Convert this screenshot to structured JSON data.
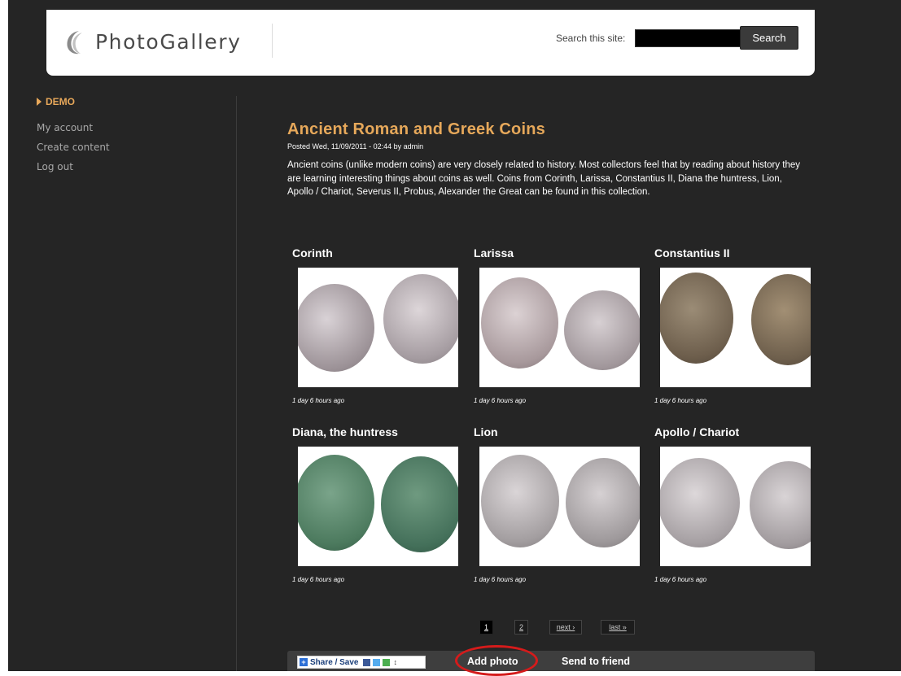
{
  "header": {
    "logo_text": "PhotoGallery",
    "search_label": "Search this site:",
    "search_value": "",
    "search_button": "Search"
  },
  "sidebar": {
    "title": "DEMO",
    "items": [
      "My account",
      "Create content",
      "Log out"
    ]
  },
  "post": {
    "title": "Ancient Roman and Greek Coins",
    "meta": "Posted Wed, 11/09/2011 - 02:44 by admin",
    "description": "Ancient coins (unlike modern coins) are very closely related to history. Most collectors feel that by reading about history they are learning interesting things about coins as well. Coins from Corinth, Larissa, Constantius II, Diana the huntress, Lion, Apollo / Chariot, Severus II, Probus, Alexander the Great can be found in this collection."
  },
  "photos": [
    {
      "title": "Corinth",
      "time": "1 day 6 hours ago",
      "tone": "silver"
    },
    {
      "title": "Larissa",
      "time": "1 day 6 hours ago",
      "tone": "silver"
    },
    {
      "title": "Constantius II",
      "time": "1 day 6 hours ago",
      "tone": "bronze"
    },
    {
      "title": "Diana, the huntress",
      "time": "1 day 6 hours ago",
      "tone": "green"
    },
    {
      "title": "Lion",
      "time": "1 day 6 hours ago",
      "tone": "silver"
    },
    {
      "title": "Apollo / Chariot",
      "time": "1 day 6 hours ago",
      "tone": "silver"
    }
  ],
  "pager": {
    "pages": [
      "1",
      "2"
    ],
    "current": "1",
    "next": "next ›",
    "last": "last »"
  },
  "actions": {
    "share": "Share / Save",
    "add_photo": "Add photo",
    "send_to_friend": "Send to friend"
  },
  "colors": {
    "accent": "#e6a85a",
    "background": "#252525",
    "highlight_circle": "#d51b1b"
  }
}
